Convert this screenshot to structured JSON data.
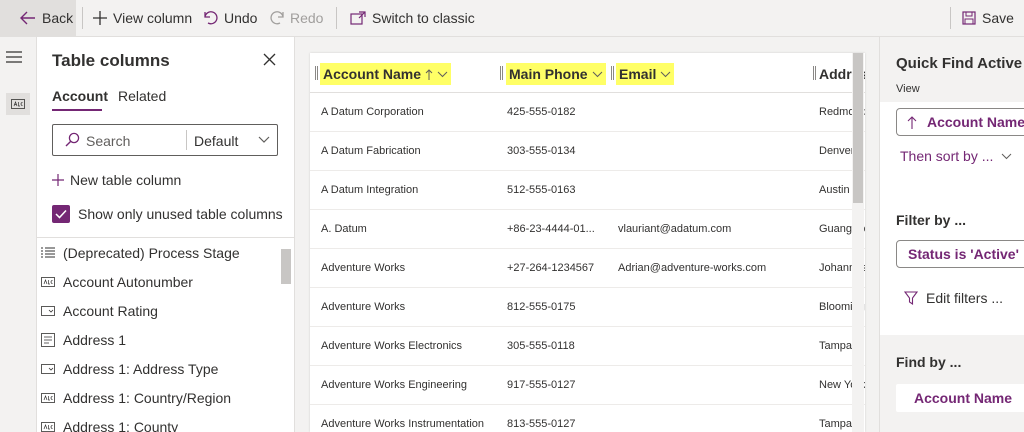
{
  "toolbar": {
    "back": "Back",
    "view_column": "View column",
    "undo": "Undo",
    "redo": "Redo",
    "switch_classic": "Switch to classic",
    "save": "Save"
  },
  "panel": {
    "title": "Table columns",
    "tabs": [
      {
        "label": "Account"
      },
      {
        "label": "Related"
      }
    ],
    "search_placeholder": "Search",
    "search_filter": "Default",
    "new_column": "New table column",
    "show_unused": "Show only unused table columns",
    "items": [
      {
        "label": "(Deprecated) Process Stage",
        "icon": "list-icon"
      },
      {
        "label": "Account Autonumber",
        "icon": "text-field-icon"
      },
      {
        "label": "Account Rating",
        "icon": "choice-field-icon"
      },
      {
        "label": "Address 1",
        "icon": "multiline-text-icon"
      },
      {
        "label": "Address 1: Address Type",
        "icon": "choice-field-icon"
      },
      {
        "label": "Address 1: Country/Region",
        "icon": "text-field-icon"
      },
      {
        "label": "Address 1: County",
        "icon": "text-field-icon"
      }
    ]
  },
  "grid": {
    "columns": [
      {
        "label": "Account Name"
      },
      {
        "label": "Main Phone"
      },
      {
        "label": "Email"
      },
      {
        "label": "Address"
      }
    ],
    "rows": [
      [
        "A Datum Corporation",
        "425-555-0182",
        "",
        "Redmond"
      ],
      [
        "A Datum Fabrication",
        "303-555-0134",
        "",
        "Denver"
      ],
      [
        "A Datum Integration",
        "512-555-0163",
        "",
        "Austin"
      ],
      [
        "A. Datum",
        "+86-23-4444-01...",
        "vlauriant@adatum.com",
        "Guangzho"
      ],
      [
        "Adventure Works",
        "+27-264-1234567",
        "Adrian@adventure-works.com",
        "Johannes"
      ],
      [
        "Adventure Works",
        "812-555-0175",
        "",
        "Blooming"
      ],
      [
        "Adventure Works Electronics",
        "305-555-0118",
        "",
        "Tampa"
      ],
      [
        "Adventure Works Engineering",
        "917-555-0127",
        "",
        "New York"
      ],
      [
        "Adventure Works Instrumentation",
        "813-555-0127",
        "",
        "Tampa"
      ]
    ]
  },
  "right": {
    "title": "Quick Find Active A",
    "subtitle": "View",
    "sort_field": "Account Name",
    "then_sort": "Then sort by ...",
    "filter_by": "Filter by ...",
    "filter_value": "Status is 'Active'",
    "edit_filters": "Edit filters ...",
    "find_by": "Find by ...",
    "find_field": "Account Name"
  },
  "colors": {
    "accent": "#742774",
    "highlight": "#ffff66"
  }
}
